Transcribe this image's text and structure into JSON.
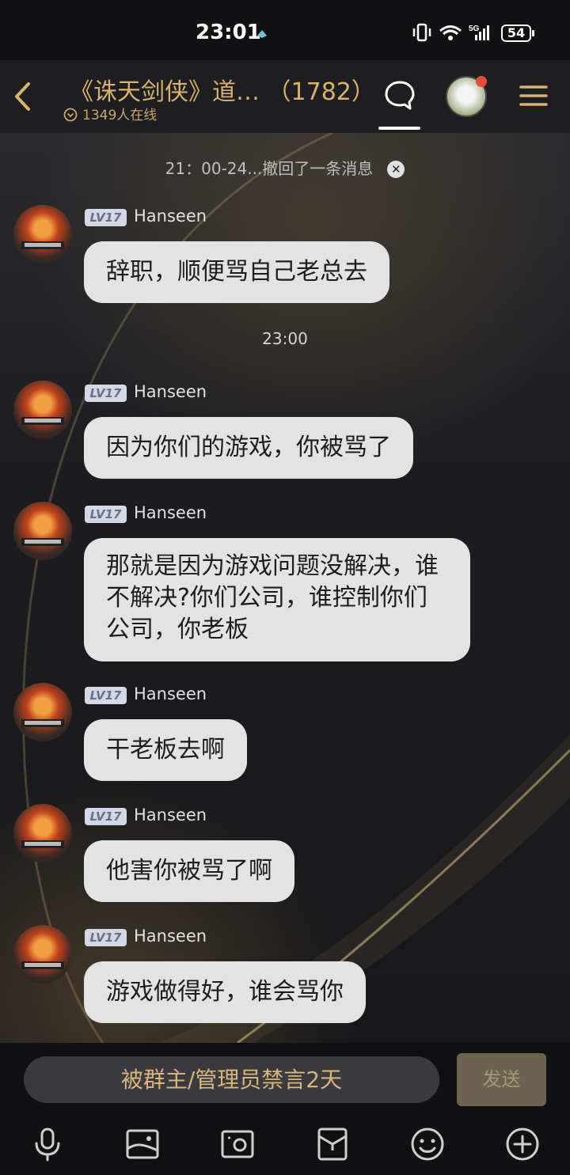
{
  "status_bar": {
    "time": "23:01",
    "network": "5G",
    "battery": "54"
  },
  "header": {
    "title": "《诛天剑侠》道… （1782）",
    "online": "1349人在线",
    "icons": [
      "back-icon",
      "chat-icon",
      "group-avatar",
      "menu-icon"
    ]
  },
  "recall_notice": "21：00-24...撤回了一条消息",
  "timestamp": "23:00",
  "messages": [
    {
      "level": "LV17",
      "sender": "Hanseen",
      "text": "辞职，顺便骂自己老总去"
    },
    {
      "level": "LV17",
      "sender": "Hanseen",
      "text": "因为你们的游戏，你被骂了"
    },
    {
      "level": "LV17",
      "sender": "Hanseen",
      "text": "那就是因为游戏问题没解决，谁不解决?你们公司，谁控制你们公司，你老板"
    },
    {
      "level": "LV17",
      "sender": "Hanseen",
      "text": "干老板去啊"
    },
    {
      "level": "LV17",
      "sender": "Hanseen",
      "text": "他害你被骂了啊"
    },
    {
      "level": "LV17",
      "sender": "Hanseen",
      "text": "游戏做得好，谁会骂你"
    }
  ],
  "input": {
    "muted_text": "被群主/管理员禁言2天",
    "send_label": "发送"
  },
  "toolbar": [
    "microphone-icon",
    "image-icon",
    "camera-icon",
    "red-packet-icon",
    "emoji-icon",
    "plus-icon"
  ],
  "colors": {
    "accent_gold": "#d9b26b",
    "bubble": "#e3e3e3",
    "badge_red": "#ee4b3a"
  }
}
